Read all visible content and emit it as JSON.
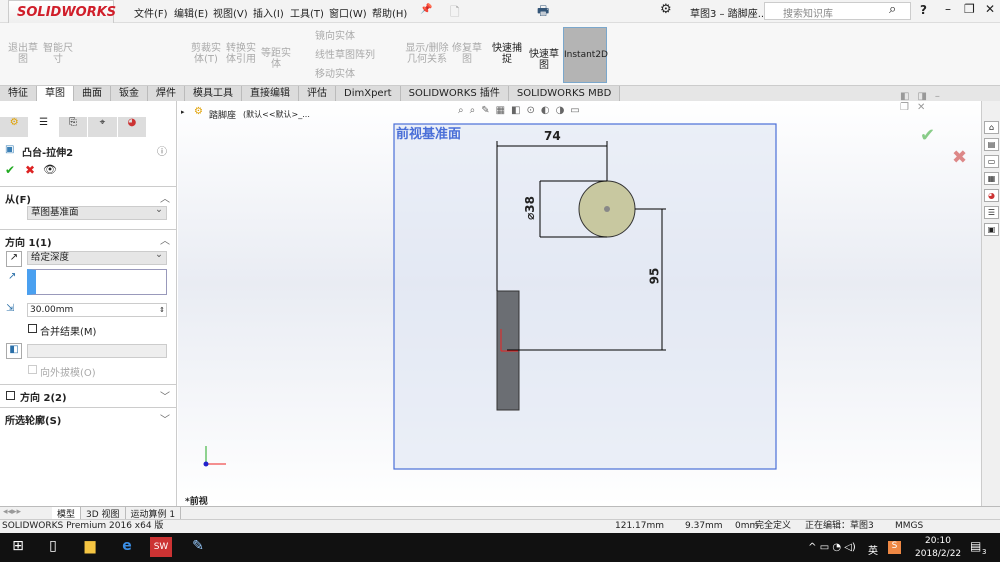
{
  "app": {
    "logo": "SOLIDWORKS",
    "doc_title": "草图3 – 踏脚座...",
    "search_placeholder": "搜索知识库"
  },
  "menu": [
    "文件(F)",
    "编辑(E)",
    "视图(V)",
    "插入(I)",
    "工具(T)",
    "窗口(W)",
    "帮助(H)"
  ],
  "ribbon": {
    "exit_sketch": "退出草图",
    "smart_dim": "智能尺寸",
    "trim": "剪裁实体(T)",
    "convert": "转换实体引用",
    "offset": "等距实体",
    "mirror": "镜向实体",
    "linear_pattern": "线性草图阵列",
    "move": "移动实体",
    "display_relations": "显示/删除几何关系",
    "repair": "修复草图",
    "rapid_snaps": "快速捕捉",
    "rapid_sketch": "快速草图",
    "instant2d": "Instant2D"
  },
  "tabs": [
    "特征",
    "草图",
    "曲面",
    "钣金",
    "焊件",
    "模具工具",
    "直接编辑",
    "评估",
    "DimXpert",
    "SOLIDWORKS 插件",
    "SOLIDWORKS MBD"
  ],
  "active_tab": "草图",
  "panel": {
    "title": "凸台-拉伸2",
    "from_label": "从(F)",
    "from_value": "草图基准面",
    "dir1_label": "方向 1(1)",
    "end_condition": "给定深度",
    "depth": "30.00mm",
    "merge": "合并结果(M)",
    "draft_outward": "向外拔模(O)",
    "dir2_label": "方向 2(2)",
    "contours_label": "所选轮廓(S)"
  },
  "tree": {
    "part": "踏脚座",
    "config": "(默认<<默认>_..."
  },
  "sketch": {
    "plane_label": "前视基准面",
    "dim_horizontal": "74",
    "dim_diameter": "⌀38",
    "dim_vertical": "95"
  },
  "view_label": "*前视",
  "bottom_tabs": [
    "模型",
    "3D 视图",
    "运动算例 1"
  ],
  "status": {
    "product": "SOLIDWORKS Premium 2016 x64 版",
    "x": "121.17mm",
    "y": "9.37mm",
    "z": "0mm",
    "state": "完全定义",
    "editing": "正在编辑：草图3",
    "units": "MMGS"
  },
  "taskbar": {
    "ime": "英",
    "time": "20:10",
    "date": "2018/2/22",
    "notifications": "3"
  }
}
